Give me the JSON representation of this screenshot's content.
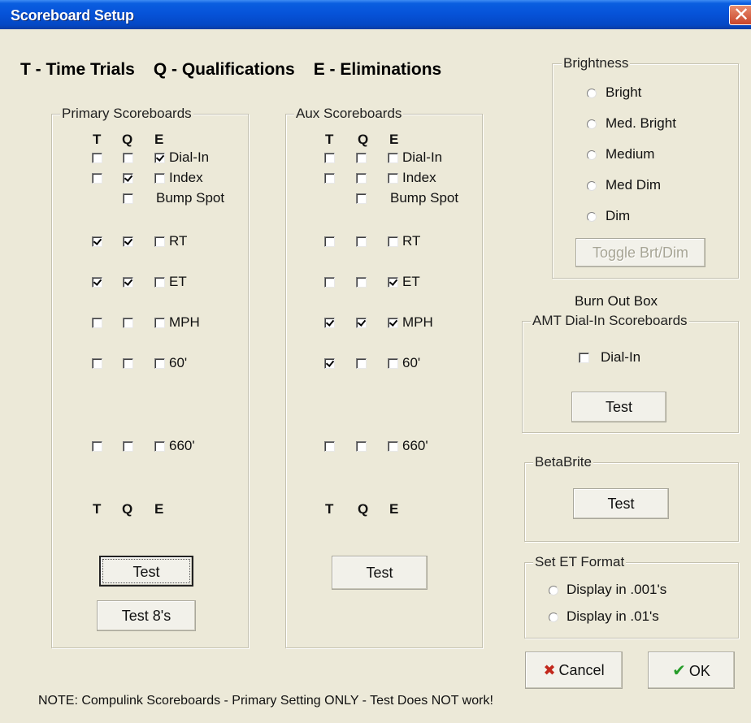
{
  "window": {
    "title": "Scoreboard Setup",
    "close_glyph": "✕"
  },
  "header": {
    "t": "T - Time Trials",
    "q": "Q - Qualifications",
    "e": "E - Eliminations"
  },
  "cols": {
    "t": "T",
    "q": "Q",
    "e": "E"
  },
  "primary": {
    "legend": "Primary Scoreboards",
    "rows": [
      {
        "label": "Dial-In",
        "t": false,
        "q": false,
        "e": true
      },
      {
        "label": "Index",
        "t": false,
        "q": true,
        "e": false
      },
      {
        "label": "Bump Spot",
        "q": false
      },
      {
        "label": "RT",
        "t": true,
        "q": true,
        "e": false
      },
      {
        "label": "ET",
        "t": true,
        "q": true,
        "e": false
      },
      {
        "label": "MPH",
        "t": false,
        "q": false,
        "e": false
      },
      {
        "label": "60'",
        "t": false,
        "q": false,
        "e": false
      },
      {
        "label": "660'",
        "t": false,
        "q": false,
        "e": false
      }
    ],
    "test_label": "Test",
    "test8_label": "Test 8's"
  },
  "aux": {
    "legend": "Aux Scoreboards",
    "rows": [
      {
        "label": "Dial-In",
        "t": false,
        "q": false,
        "e": false
      },
      {
        "label": "Index",
        "t": false,
        "q": false,
        "e": false
      },
      {
        "label": "Bump Spot",
        "q": false
      },
      {
        "label": "RT",
        "t": false,
        "q": false,
        "e": false
      },
      {
        "label": "ET",
        "t": false,
        "q": false,
        "e": true
      },
      {
        "label": "MPH",
        "t": true,
        "q": true,
        "e": true
      },
      {
        "label": "60'",
        "t": true,
        "q": false,
        "e": false
      },
      {
        "label": "660'",
        "t": false,
        "q": false,
        "e": false
      }
    ],
    "test_label": "Test"
  },
  "brightness": {
    "legend": "Brightness",
    "options": [
      "Bright",
      "Med. Bright",
      "Medium",
      "Med Dim",
      "Dim"
    ],
    "toggle_label": "Toggle Brt/Dim"
  },
  "burnout": {
    "caption": "Burn Out Box",
    "legend": "AMT Dial-In Scoreboards",
    "dialin_label": "Dial-In",
    "dialin_checked": false,
    "test_label": "Test"
  },
  "betabrite": {
    "legend": "BetaBrite",
    "test_label": "Test"
  },
  "et_format": {
    "legend": "Set ET Format",
    "options": [
      "Display in .001's",
      "Display in .01's"
    ]
  },
  "actions": {
    "cancel_label": "Cancel",
    "ok_label": "OK"
  },
  "note": "NOTE:  Compulink Scoreboards - Primary Setting ONLY - Test Does NOT work!"
}
